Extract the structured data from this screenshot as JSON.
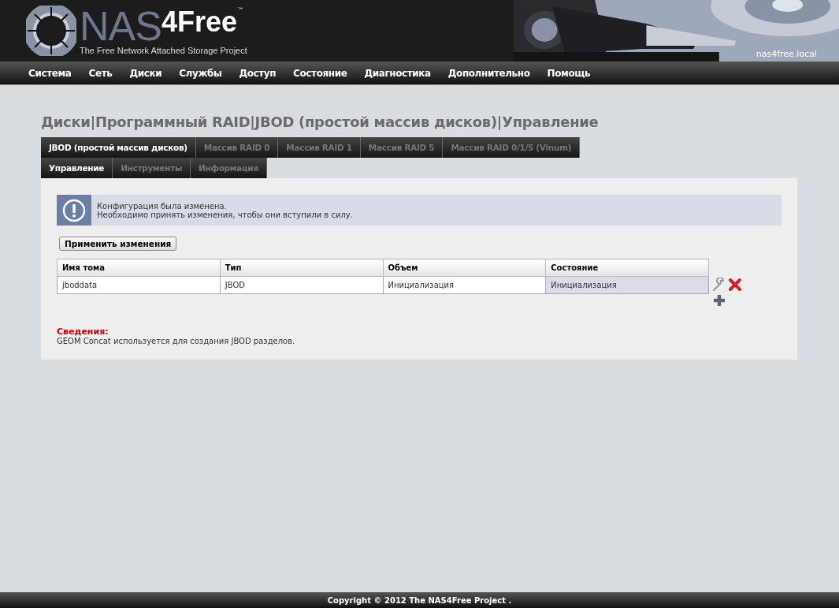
{
  "header": {
    "logo_prefix": "NAS",
    "logo_suffix": "4Free",
    "trademark": "™",
    "tagline": "The Free Network Attached Storage Project",
    "hostname": "nas4free.local"
  },
  "nav": [
    "Система",
    "Сеть",
    "Диски",
    "Службы",
    "Доступ",
    "Состояние",
    "Диагностика",
    "Дополнительно",
    "Помощь"
  ],
  "page_title": "Диски|Программный RAID|JBOD (простой массив дисков)|Управление",
  "tabs": [
    {
      "label": "JBOD (простой массив дисков)",
      "selected": true
    },
    {
      "label": "Массив RAID 0",
      "selected": false
    },
    {
      "label": "Массив RAID 1",
      "selected": false
    },
    {
      "label": "Массив RAID 5",
      "selected": false
    },
    {
      "label": "Массив RAID 0/1/5 (Vinum)",
      "selected": false
    }
  ],
  "subtabs": [
    {
      "label": "Управление",
      "selected": true
    },
    {
      "label": "Инструменты",
      "selected": false
    },
    {
      "label": "Информация",
      "selected": false
    }
  ],
  "notice": {
    "lines": [
      "Конфигурация была изменена.",
      "Необходимо принять изменения, чтобы они вступили в силу."
    ]
  },
  "apply_button": "Применить изменения",
  "table": {
    "columns": [
      "Имя тома",
      "Тип",
      "Объем",
      "Состояние"
    ],
    "rows": [
      {
        "cells": [
          "jboddata",
          "JBOD",
          "Инициализация",
          "Инициализация"
        ]
      }
    ]
  },
  "info": {
    "title": "Сведения:",
    "text": "GEOM Concat используется для создания JBOD разделов."
  },
  "footer": "Copyright © 2012 The NAS4Free Project ."
}
